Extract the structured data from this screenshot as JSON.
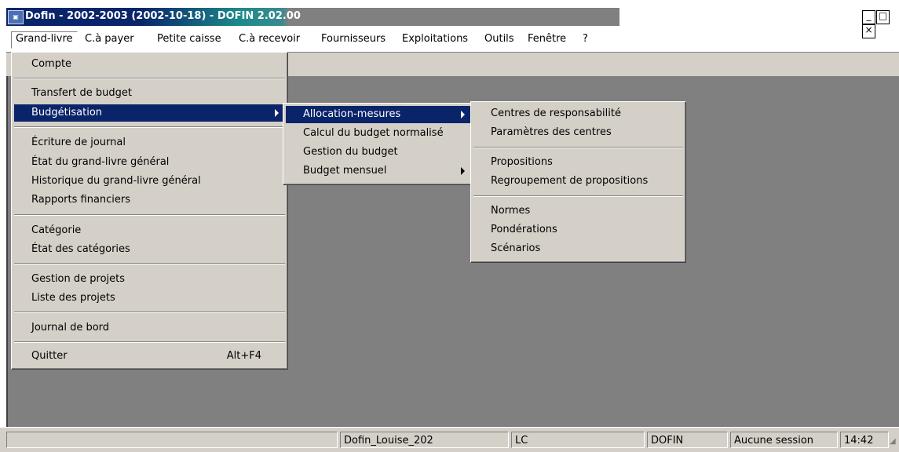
{
  "window": {
    "title": "Dofin - 2002-2003 (2002-10-18) - DOFIN 2.02.00",
    "icon": "app-icon",
    "controls": [
      "_",
      "□",
      "×"
    ]
  },
  "menubar": [
    {
      "label": "Grand-livre",
      "active": true
    },
    {
      "label": "C.à payer"
    },
    {
      "label": "Petite caisse"
    },
    {
      "label": "C.à recevoir"
    },
    {
      "label": "Fournisseurs"
    },
    {
      "label": "Exploitations"
    },
    {
      "label": "Outils"
    },
    {
      "label": "Fenêtre"
    },
    {
      "label": "?"
    }
  ],
  "grand_livre_menu": {
    "items": [
      {
        "label": "Compte"
      },
      {
        "label": "Transfert de budget"
      },
      {
        "label": "Budgétisation",
        "submenu": true,
        "highlighted": true
      },
      {
        "label": "Écriture de journal"
      },
      {
        "label": "État du grand-livre général"
      },
      {
        "label": "Historique du grand-livre général"
      },
      {
        "label": "Rapports financiers"
      },
      {
        "label": "Catégorie"
      },
      {
        "label": "État des catégories"
      },
      {
        "label": "Gestion de projets"
      },
      {
        "label": "Liste des projets"
      },
      {
        "label": "Journal de bord"
      },
      {
        "label": "Quitter",
        "shortcut": "Alt+F4"
      }
    ]
  },
  "budgetisation_menu": {
    "items": [
      {
        "label": "Allocation-mesures",
        "submenu": true,
        "highlighted": true
      },
      {
        "label": "Calcul du budget normalisé"
      },
      {
        "label": "Gestion du budget"
      },
      {
        "label": "Budget mensuel",
        "submenu": true
      }
    ]
  },
  "allocation_menu": {
    "items": [
      {
        "label": "Centres de responsabilité"
      },
      {
        "label": "Paramètres des centres"
      },
      {
        "label": "Propositions"
      },
      {
        "label": "Regroupement de propositions"
      },
      {
        "label": "Normes"
      },
      {
        "label": "Pondérations"
      },
      {
        "label": "Scénarios"
      }
    ]
  },
  "statusbar": {
    "database": "Dofin_Louise_202",
    "user": "LC",
    "app": "DOFIN",
    "session": "Aucune session",
    "time": "14:42"
  },
  "colors": {
    "title_active": "#0a246a",
    "menu_face": "#d4d0c8",
    "highlight": "#0a246a",
    "mdi_background": "#808080"
  }
}
